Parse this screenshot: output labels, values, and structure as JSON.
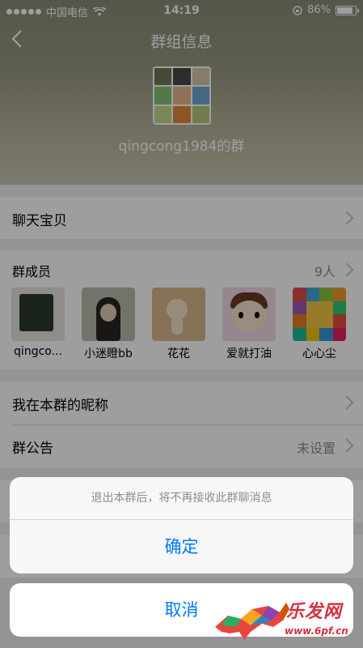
{
  "status_bar": {
    "carrier": "中国电信",
    "time": "14:19",
    "battery": "86%",
    "battery_level": 0.86
  },
  "nav": {
    "title": "群组信息"
  },
  "group": {
    "name": "qingcong1984的群"
  },
  "chat_baby": {
    "label": "聊天宝贝"
  },
  "members_section": {
    "label": "群成员",
    "count": "9人",
    "items": [
      {
        "name": "qingco..."
      },
      {
        "name": "小迷瞪bb"
      },
      {
        "name": "花花"
      },
      {
        "name": "爱就打油"
      },
      {
        "name": "心心尘"
      }
    ]
  },
  "nickname": {
    "label": "我在本群的昵称"
  },
  "notice": {
    "label": "群公告",
    "value": "未设置"
  },
  "action_sheet": {
    "message": "退出本群后，将不再接收此群聊消息",
    "confirm": "确定",
    "cancel": "取消"
  },
  "watermark": {
    "text": "乐发网",
    "url": "www.6pf.cn"
  },
  "colors": {
    "accent": "#007aff",
    "watermark": "#d6303f"
  }
}
